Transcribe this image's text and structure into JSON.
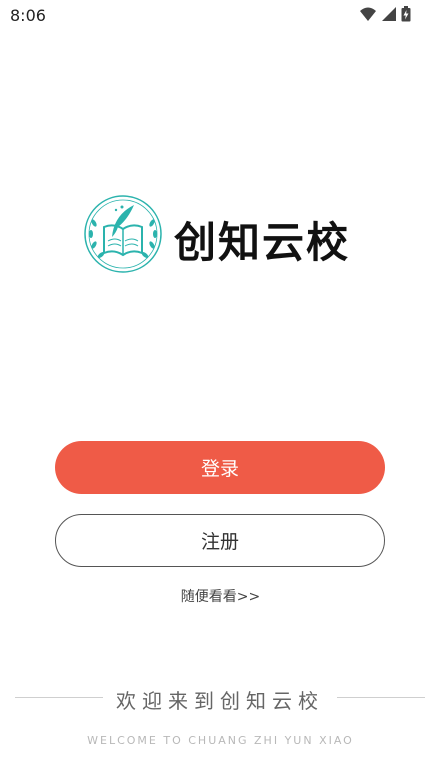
{
  "status": {
    "time": "8:06",
    "icons": [
      "wifi-icon",
      "signal-icon",
      "battery-icon"
    ]
  },
  "logo": {
    "name": "创知云校",
    "emblem_icon": "book-quill-laurel-icon",
    "color": "#2bb3ad"
  },
  "buttons": {
    "login": "登录",
    "register": "注册"
  },
  "browse_link": "随便看看>>",
  "welcome": {
    "title": "欢迎来到创知云校",
    "subtitle": "WELCOME TO CHUANG ZHI YUN XIAO"
  },
  "colors": {
    "accent": "#ef5b47",
    "text": "#333333"
  }
}
